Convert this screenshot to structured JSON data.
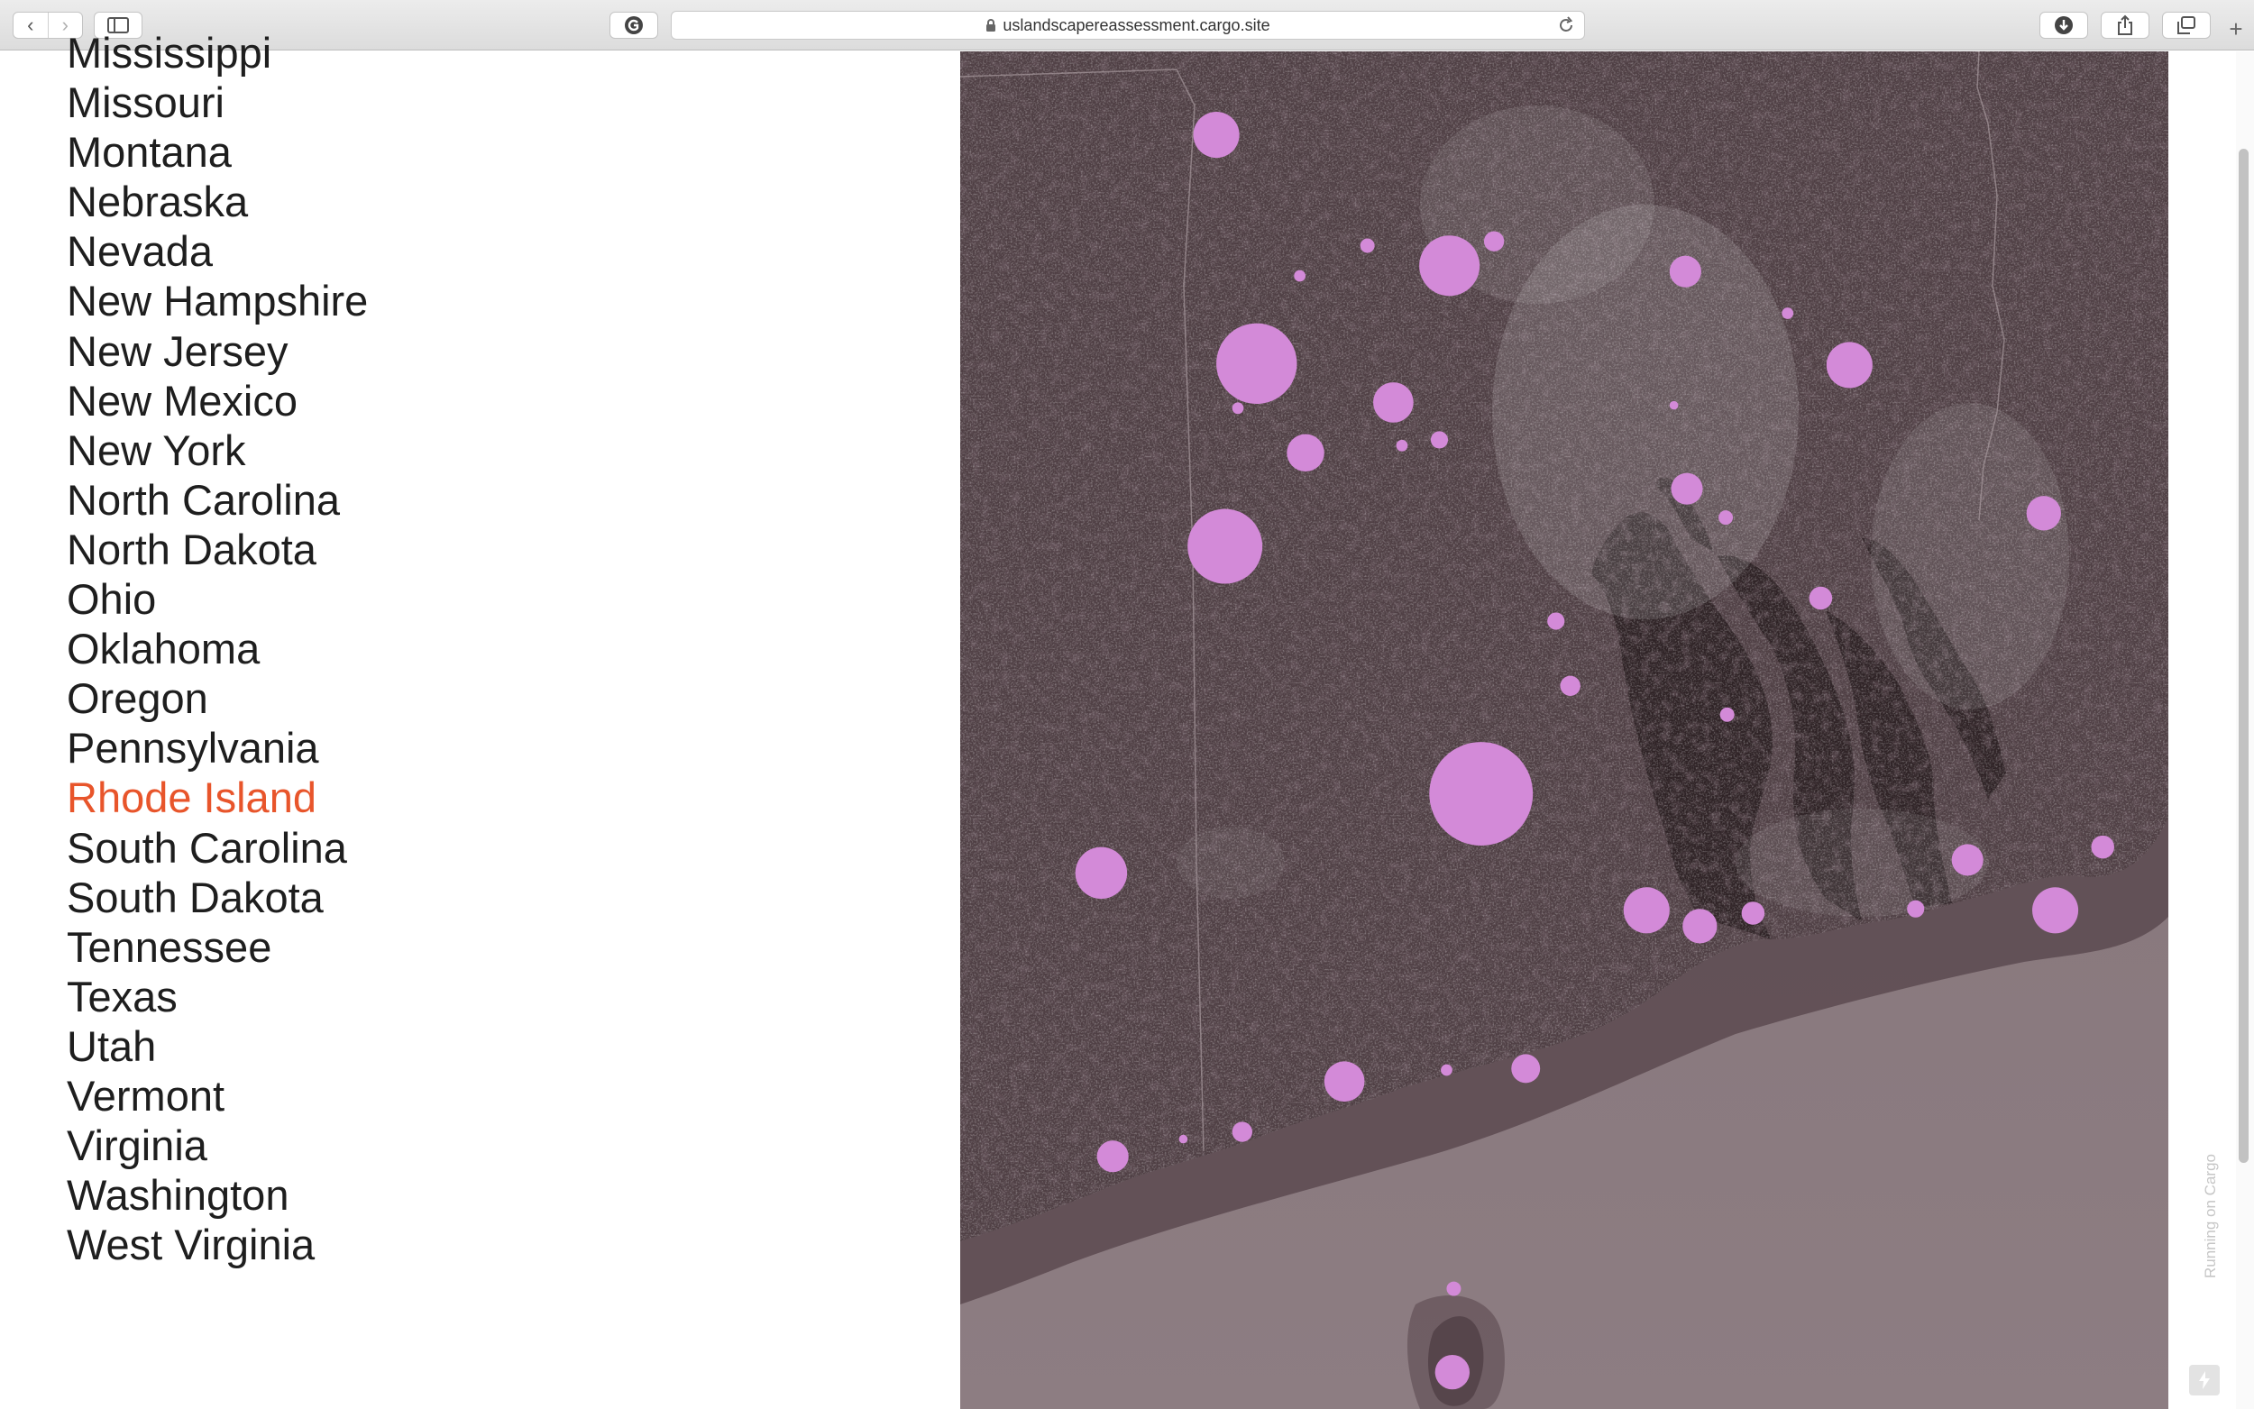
{
  "browser": {
    "url": "uslandscapereassessment.cargo.site",
    "back_glyph": "‹",
    "forward_glyph": "›",
    "newtab_glyph": "+",
    "icons": [
      "chevron-left-icon",
      "chevron-right-icon",
      "sidebar-icon",
      "extension-icon",
      "lock-icon",
      "reload-icon",
      "download-icon",
      "share-icon",
      "tabs-icon",
      "plus-icon"
    ]
  },
  "states": [
    "Mississippi",
    "Missouri",
    "Montana",
    "Nebraska",
    "Nevada",
    "New Hampshire",
    "New Jersey",
    "New Mexico",
    "New York",
    "North Carolina",
    "North Dakota",
    "Ohio",
    "Oklahoma",
    "Oregon",
    "Pennsylvania",
    "Rhode Island",
    "South Carolina",
    "South Dakota",
    "Tennessee",
    "Texas",
    "Utah",
    "Vermont",
    "Virginia",
    "Washington",
    "West Virginia"
  ],
  "selected_state": "Rhode Island",
  "footer": {
    "cargo_label": "Running on Cargo",
    "bolt_icon": "bolt-icon"
  },
  "colors": {
    "selected": "#e8552b",
    "text": "#1e1e1e",
    "marker": "#d38ad8",
    "land": "#4f3f44",
    "water": "#2f2326",
    "ocean": "#847479"
  }
}
